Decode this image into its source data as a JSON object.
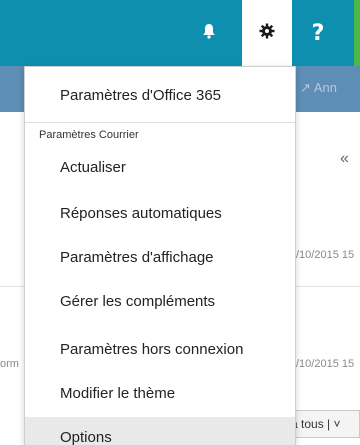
{
  "topbar": {
    "help_label": "?"
  },
  "background": {
    "reply_all": "↗ Ann",
    "date_1": "/10/2015 15",
    "date_2": "/10/2015 15",
    "left_fragment": "orm",
    "reply_pill": "à tous  |  ˅"
  },
  "menu": {
    "office_settings": "Paramètres d'Office 365",
    "mail_section": "Paramètres Courrier",
    "items": [
      "Actualiser",
      "Réponses automatiques",
      "Paramètres d'affichage",
      "Gérer les compléments",
      "Paramètres hors connexion",
      "Modifier le thème",
      "Options"
    ]
  },
  "colors": {
    "topbar": "#0f8fb0",
    "secondbar": "#5e8db5",
    "accent_green": "#4bb748",
    "hover": "#e9e9e9"
  }
}
